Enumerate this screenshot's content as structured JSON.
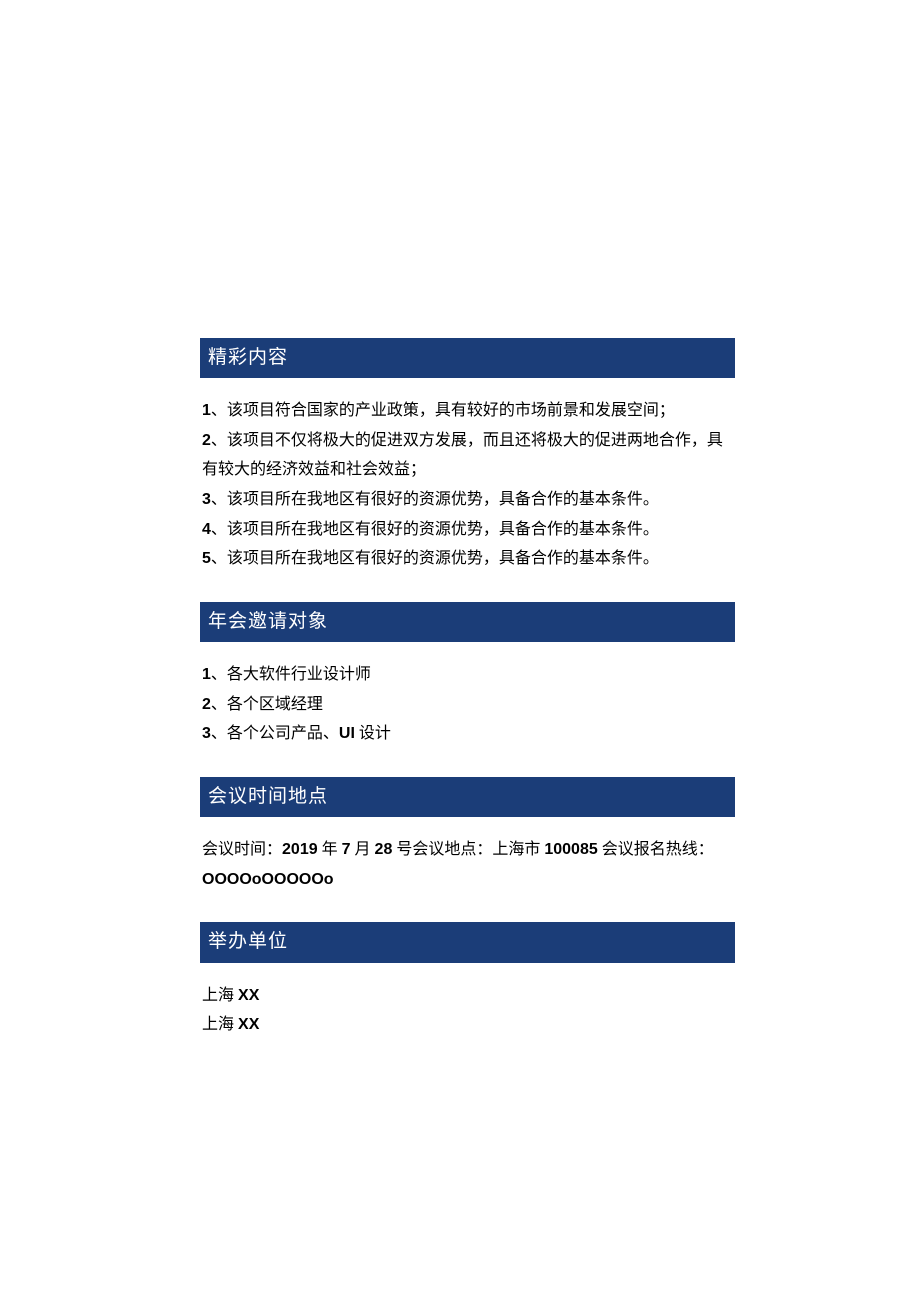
{
  "sections": {
    "content": {
      "header": "精彩内容",
      "items": [
        "1、该项目符合国家的产业政策，具有较好的市场前景和发展空间；",
        "2、该项目不仅将极大的促进双方发展，而且还将极大的促进两地合作，具有较大的经济效益和社会效益；",
        "3、该项目所在我地区有很好的资源优势，具备合作的基本条件。",
        "4、该项目所在我地区有很好的资源优势，具备合作的基本条件。",
        "5、该项目所在我地区有很好的资源优势，具备合作的基本条件。"
      ]
    },
    "invitees": {
      "header": "年会邀请对象",
      "items": [
        "1、各大软件行业设计师",
        "2、各个区域经理",
        "3、各个公司产品、UI 设计"
      ]
    },
    "meeting": {
      "header": "会议时间地点",
      "time_label": "会议时间：",
      "date_year": "2019",
      "date_year_suffix": " 年 ",
      "date_month": "7",
      "date_month_suffix": " 月 ",
      "date_day": "28",
      "date_day_suffix": " 号会议地点：上海市 ",
      "postal": "100085",
      "postal_suffix": " 会议报名热线：",
      "hotline": "OOOOoOOOOOo"
    },
    "organizer": {
      "header": "举办单位",
      "items_prefix": "上海 ",
      "items_name": "XX",
      "items": [
        "上海 XX",
        "上海 XX"
      ]
    }
  }
}
